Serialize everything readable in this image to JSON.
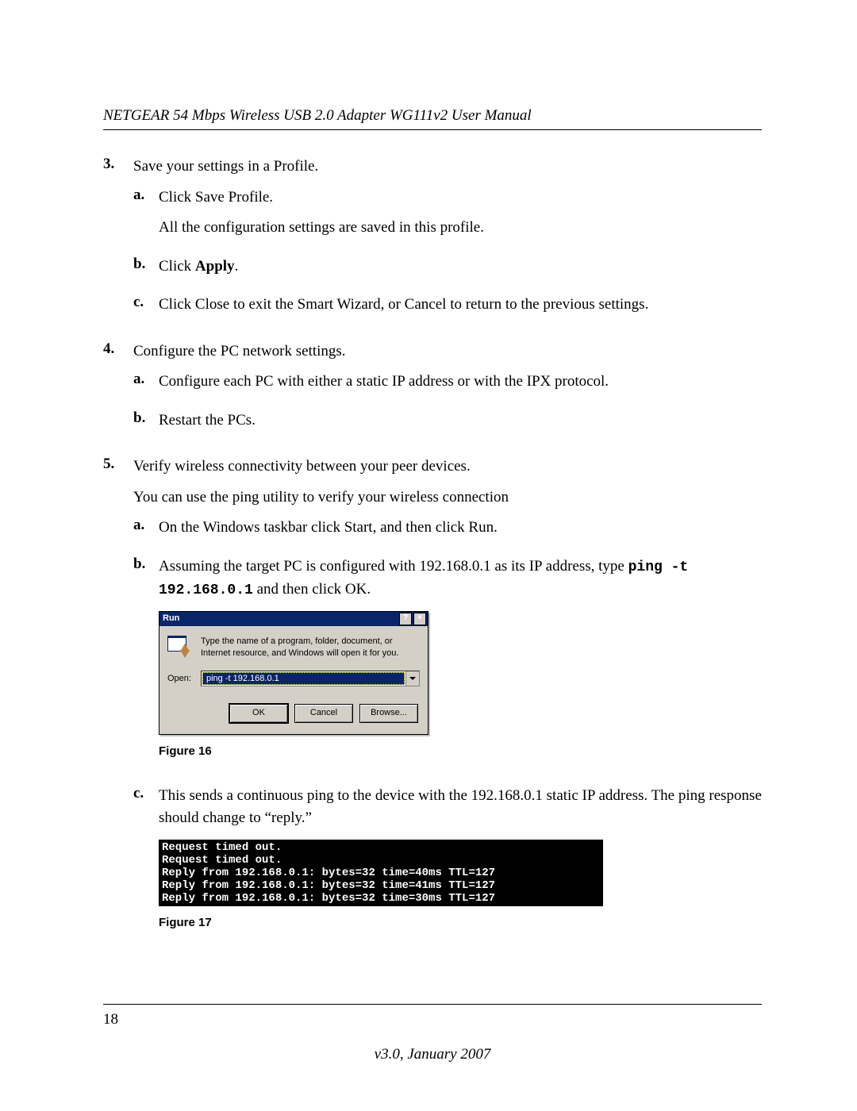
{
  "header": {
    "title": "NETGEAR 54 Mbps Wireless USB 2.0 Adapter WG111v2 User Manual"
  },
  "steps": {
    "s3": {
      "num": "3.",
      "text": "Save your settings in a Profile.",
      "a_label": "a.",
      "a_text1": "Click Save Profile.",
      "a_text2": "All the configuration settings are saved in this profile.",
      "b_label": "b.",
      "b_prefix": "Click ",
      "b_bold": "Apply",
      "b_suffix": ".",
      "c_label": "c.",
      "c_text": "Click Close to exit the Smart Wizard, or Cancel to return to the previous settings."
    },
    "s4": {
      "num": "4.",
      "text": "Configure the PC network settings.",
      "a_label": "a.",
      "a_text": "Configure each PC with either a static IP address or with the IPX protocol.",
      "b_label": "b.",
      "b_text": "Restart the PCs."
    },
    "s5": {
      "num": "5.",
      "text": "Verify wireless connectivity between your peer devices.",
      "intro": "You can use the ping utility to verify your wireless connection",
      "a_label": "a.",
      "a_text": "On the Windows taskbar click Start, and then click Run.",
      "b_label": "b.",
      "b_prefix": "Assuming the target PC is configured with 192.168.0.1 as its IP address, type ",
      "b_cmd": "ping -t 192.168.0.1",
      "b_suffix": " and then click OK.",
      "c_label": "c.",
      "c_text": "This sends a continuous ping to the device with the 192.168.0.1 static IP address. The ping response should change to “reply.”"
    }
  },
  "run_dialog": {
    "title": "Run",
    "help": "?",
    "close": "×",
    "desc": "Type the name of a program, folder, document, or Internet resource, and Windows will open it for you.",
    "open_label": "Open:",
    "open_value": "ping -t 192.168.0.1",
    "ok": "OK",
    "cancel": "Cancel",
    "browse": "Browse..."
  },
  "figures": {
    "fig16": "Figure 16",
    "fig17": "Figure 17"
  },
  "terminal": {
    "line1": "Request timed out.",
    "line2": "Request timed out.",
    "line3": "Reply from 192.168.0.1: bytes=32 time=40ms TTL=127",
    "line4": "Reply from 192.168.0.1: bytes=32 time=41ms TTL=127",
    "line5": "Reply from 192.168.0.1: bytes=32 time=30ms TTL=127"
  },
  "footer": {
    "page": "18",
    "version": "v3.0, January 2007"
  }
}
